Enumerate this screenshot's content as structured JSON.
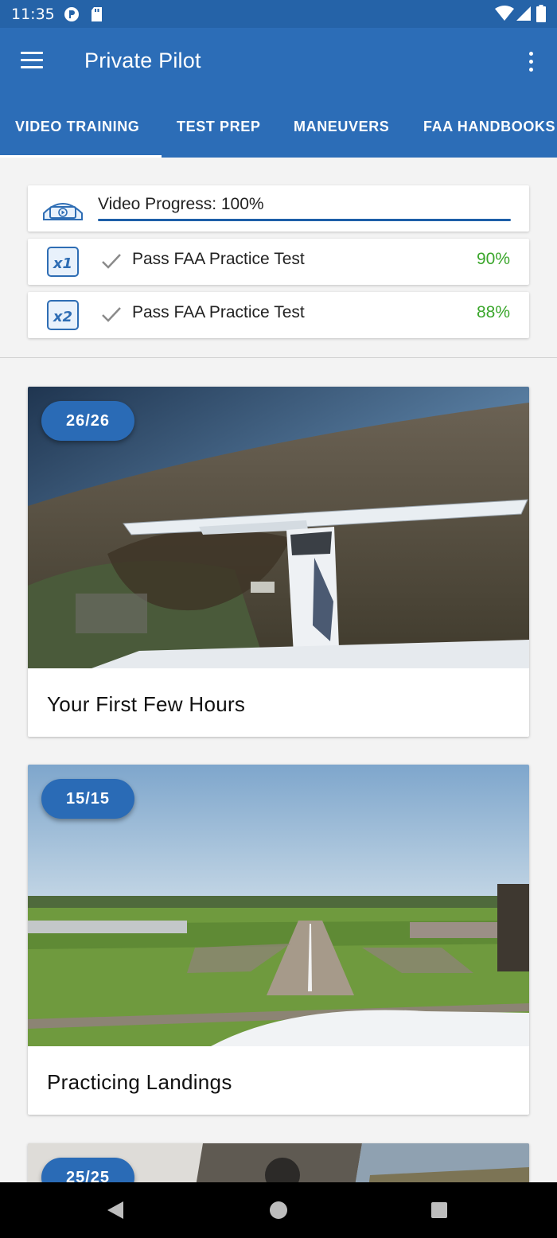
{
  "status_bar": {
    "time": "11:35",
    "icons": [
      "signal-app-icon",
      "sd-card-icon",
      "wifi-icon",
      "cell-signal-icon",
      "battery-icon"
    ]
  },
  "app_bar": {
    "title": "Private Pilot",
    "menu_icon": "hamburger-menu-icon",
    "overflow_icon": "more-vert-icon",
    "color": "#2c6db7"
  },
  "tabs": [
    {
      "label": "VIDEO TRAINING",
      "selected": true
    },
    {
      "label": "TEST PREP",
      "selected": false
    },
    {
      "label": "MANEUVERS",
      "selected": false
    },
    {
      "label": "FAA HANDBOOKS",
      "selected": false
    }
  ],
  "progress": {
    "video": {
      "label": "Video Progress: 100%",
      "value": 1.0,
      "icon": "video-play-icon"
    },
    "tests": [
      {
        "icon": "x1-test-icon",
        "label": "Pass FAA Practice Test",
        "score": "90%",
        "passed": true
      },
      {
        "icon": "x2-test-icon",
        "label": "Pass FAA Practice Test",
        "score": "88%",
        "passed": true
      }
    ],
    "pass_color": "#3aa62b"
  },
  "lessons": [
    {
      "badge": "26/26",
      "title": "Your First Few Hours",
      "image": "aerial view from airplane wing over fields"
    },
    {
      "badge": "15/15",
      "title": "Practicing Landings",
      "image": "runway approach over green airfield"
    },
    {
      "badge": "25/25",
      "title": "",
      "image": "cockpit view over farmland"
    }
  ],
  "nav_bar": {
    "icons": [
      "back-icon",
      "home-icon",
      "recents-icon"
    ]
  }
}
